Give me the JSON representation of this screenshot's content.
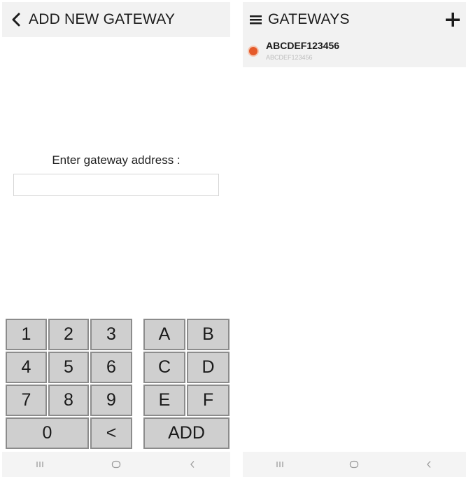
{
  "left_screen": {
    "title": "ADD NEW GATEWAY",
    "prompt": "Enter gateway address :",
    "address_value": "",
    "keypad": {
      "numeric": [
        [
          "1",
          "2",
          "3"
        ],
        [
          "4",
          "5",
          "6"
        ],
        [
          "7",
          "8",
          "9"
        ]
      ],
      "hex": [
        [
          "A",
          "B"
        ],
        [
          "C",
          "D"
        ],
        [
          "E",
          "F"
        ]
      ],
      "zero": "0",
      "backspace": "<",
      "add": "ADD"
    }
  },
  "right_screen": {
    "title": "GATEWAYS",
    "gateways": [
      {
        "name": "ABCDEF123456",
        "subtitle": "ABCDEF123456"
      }
    ]
  },
  "icons": {
    "back": "chevron-left-icon",
    "menu": "hamburger-icon",
    "add": "plus-icon",
    "status": "status-dot-icon",
    "recents": "recents-icon",
    "home": "home-icon",
    "nav_back": "nav-back-icon"
  },
  "colors": {
    "appbar_bg": "#f2f2f2",
    "key_bg": "#cfcfcf",
    "key_border": "#8c8c8c",
    "status_dot": "#e55a2a"
  }
}
